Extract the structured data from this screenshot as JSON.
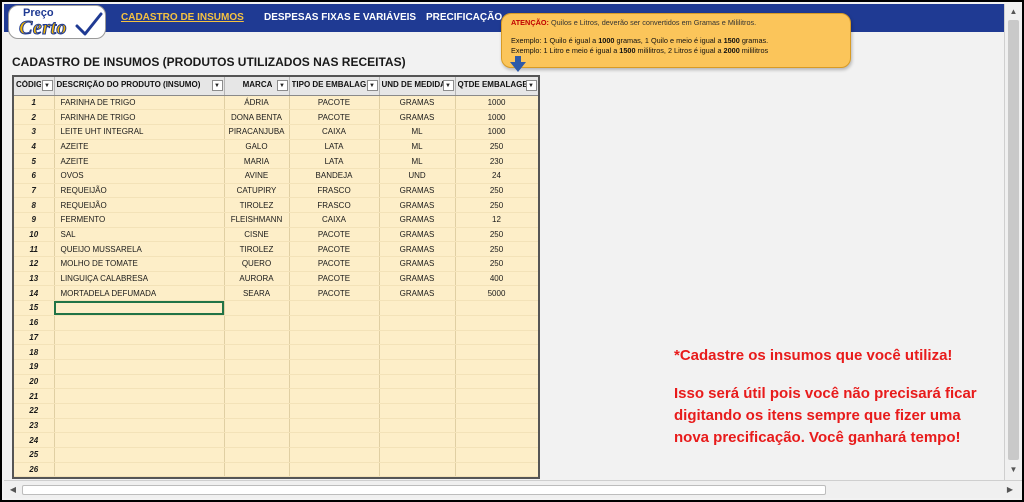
{
  "logo": {
    "line1": "Preço",
    "line2": "Certo"
  },
  "nav": [
    {
      "label": "CADASTRO DE INSUMOS",
      "active": true
    },
    {
      "label": "DESPESAS FIXAS E VARIÁVEIS",
      "active": false
    },
    {
      "label": "PRECIFICAÇÃO",
      "active": false
    }
  ],
  "tooltip": {
    "head_bold": "ATENÇÃO:",
    "head_text": " Quilos e Litros, deverão ser convertidos em Gramas e Mililitros.",
    "ex1_a": "Exemplo: 1 Quilo é igual a ",
    "ex1_b": "1000",
    "ex1_c": " gramas, 1 Quilo e meio é igual a ",
    "ex1_d": "1500",
    "ex1_e": " gramas.",
    "ex2_a": "Exemplo: 1 Litro e meio é igual a ",
    "ex2_b": "1500",
    "ex2_c": " mililitros, 2 Litros é igual a ",
    "ex2_d": "2000",
    "ex2_e": " mililitros"
  },
  "page_title": "CADASTRO DE INSUMOS (PRODUTOS UTILIZADOS NAS RECEITAS)",
  "columns": [
    "CÓDIGO",
    "DESCRIÇÃO DO PRODUTO (INSUMO)",
    "MARCA",
    "TIPO DE EMBALAGEM",
    "UND DE MEDIDA",
    "QTDE EMBALAGEM"
  ],
  "rows": [
    {
      "id": "1",
      "desc": "FARINHA DE TRIGO",
      "marca": "ÁDRIA",
      "tipo": "PACOTE",
      "und": "GRAMAS",
      "qtde": "1000"
    },
    {
      "id": "2",
      "desc": "FARINHA DE TRIGO",
      "marca": "DONA BENTA",
      "tipo": "PACOTE",
      "und": "GRAMAS",
      "qtde": "1000"
    },
    {
      "id": "3",
      "desc": "LEITE UHT INTEGRAL",
      "marca": "PIRACANJUBA",
      "tipo": "CAIXA",
      "und": "ML",
      "qtde": "1000"
    },
    {
      "id": "4",
      "desc": "AZEITE",
      "marca": "GALO",
      "tipo": "LATA",
      "und": "ML",
      "qtde": "250"
    },
    {
      "id": "5",
      "desc": "AZEITE",
      "marca": "MARIA",
      "tipo": "LATA",
      "und": "ML",
      "qtde": "230"
    },
    {
      "id": "6",
      "desc": "OVOS",
      "marca": "AVINE",
      "tipo": "BANDEJA",
      "und": "UND",
      "qtde": "24"
    },
    {
      "id": "7",
      "desc": "REQUEIJÃO",
      "marca": "CATUPIRY",
      "tipo": "FRASCO",
      "und": "GRAMAS",
      "qtde": "250"
    },
    {
      "id": "8",
      "desc": "REQUEIJÃO",
      "marca": "TIROLEZ",
      "tipo": "FRASCO",
      "und": "GRAMAS",
      "qtde": "250"
    },
    {
      "id": "9",
      "desc": "FERMENTO",
      "marca": "FLEISHMANN",
      "tipo": "CAIXA",
      "und": "GRAMAS",
      "qtde": "12"
    },
    {
      "id": "10",
      "desc": "SAL",
      "marca": "CISNE",
      "tipo": "PACOTE",
      "und": "GRAMAS",
      "qtde": "250"
    },
    {
      "id": "11",
      "desc": "QUEIJO MUSSARELA",
      "marca": "TIROLEZ",
      "tipo": "PACOTE",
      "und": "GRAMAS",
      "qtde": "250"
    },
    {
      "id": "12",
      "desc": "MOLHO DE TOMATE",
      "marca": "QUERO",
      "tipo": "PACOTE",
      "und": "GRAMAS",
      "qtde": "250"
    },
    {
      "id": "13",
      "desc": "LINGUIÇA CALABRESA",
      "marca": "AURORA",
      "tipo": "PACOTE",
      "und": "GRAMAS",
      "qtde": "400"
    },
    {
      "id": "14",
      "desc": "MORTADELA DEFUMADA",
      "marca": "SEARA",
      "tipo": "PACOTE",
      "und": "GRAMAS",
      "qtde": "5000"
    },
    {
      "id": "15",
      "desc": "",
      "marca": "",
      "tipo": "",
      "und": "",
      "qtde": ""
    },
    {
      "id": "16",
      "desc": "",
      "marca": "",
      "tipo": "",
      "und": "",
      "qtde": ""
    },
    {
      "id": "17",
      "desc": "",
      "marca": "",
      "tipo": "",
      "und": "",
      "qtde": ""
    },
    {
      "id": "18",
      "desc": "",
      "marca": "",
      "tipo": "",
      "und": "",
      "qtde": ""
    },
    {
      "id": "19",
      "desc": "",
      "marca": "",
      "tipo": "",
      "und": "",
      "qtde": ""
    },
    {
      "id": "20",
      "desc": "",
      "marca": "",
      "tipo": "",
      "und": "",
      "qtde": ""
    },
    {
      "id": "21",
      "desc": "",
      "marca": "",
      "tipo": "",
      "und": "",
      "qtde": ""
    },
    {
      "id": "22",
      "desc": "",
      "marca": "",
      "tipo": "",
      "und": "",
      "qtde": ""
    },
    {
      "id": "23",
      "desc": "",
      "marca": "",
      "tipo": "",
      "und": "",
      "qtde": ""
    },
    {
      "id": "24",
      "desc": "",
      "marca": "",
      "tipo": "",
      "und": "",
      "qtde": ""
    },
    {
      "id": "25",
      "desc": "",
      "marca": "",
      "tipo": "",
      "und": "",
      "qtde": ""
    },
    {
      "id": "26",
      "desc": "",
      "marca": "",
      "tipo": "",
      "und": "",
      "qtde": ""
    }
  ],
  "info": {
    "line1": "*Cadastre os insumos que você utiliza!",
    "line2": "Isso será útil pois você não precisará ficar digitando os itens sempre que fizer uma nova precificação. Você ganhará tempo!"
  },
  "colors": {
    "nav_bg": "#1f3a93",
    "nav_active": "#f5c242",
    "table_bg": "#fdeec8",
    "tooltip_bg": "#fbc55a",
    "info_text": "#e81b1b"
  }
}
